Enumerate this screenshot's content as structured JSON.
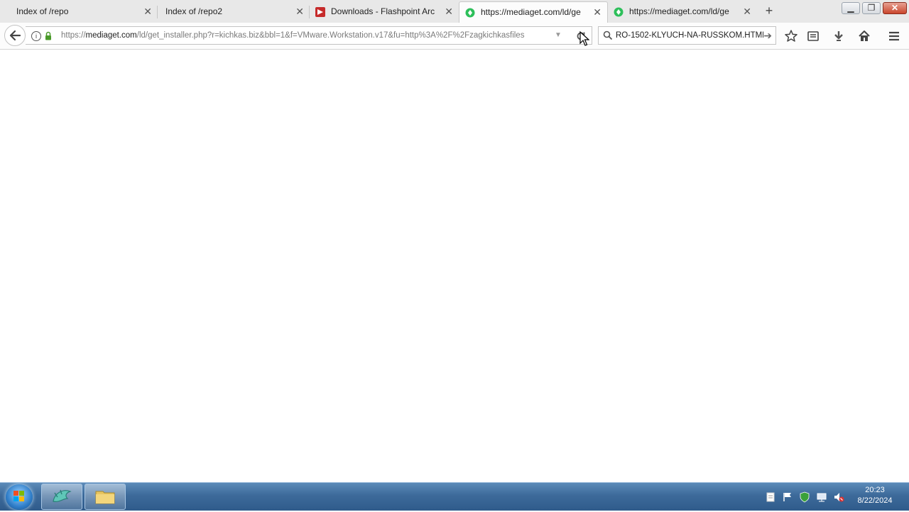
{
  "tabs": [
    {
      "title": "Index of /repo",
      "favicon": "none",
      "selected": false
    },
    {
      "title": "Index of /repo2",
      "favicon": "none",
      "selected": false
    },
    {
      "title": "Downloads - Flashpoint Arc",
      "favicon": "flashpoint-icon",
      "selected": false
    },
    {
      "title": "https://mediaget.com/ld/ge",
      "favicon": "mediaget-icon",
      "selected": true
    },
    {
      "title": "https://mediaget.com/ld/ge",
      "favicon": "mediaget-icon",
      "selected": false
    }
  ],
  "navbar": {
    "url_prefix": "https://",
    "url_domain": "mediaget.com",
    "url_path": "/ld/get_installer.php?r=kichkas.biz&bbl=1&f=VMware.Workstation.v17&fu=http%3A%2F%2Fzagkichkasfiles",
    "search_value": "RO-1502-KLYUCH-NA-RUSSKOM.HTML"
  },
  "taskbar": {
    "time": "20:23",
    "date": "8/22/2024"
  },
  "colors": {
    "mediaget_green": "#2dbf5a",
    "flashpoint_red": "#c62b2b"
  }
}
